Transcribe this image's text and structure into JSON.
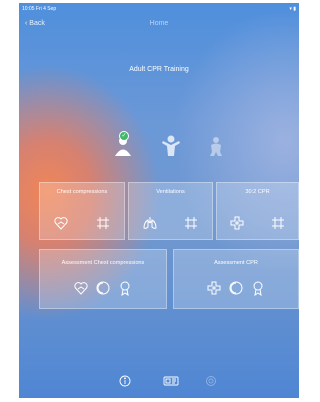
{
  "status": {
    "time": "10:05  Fri 4 Sep",
    "right": "▾ ▮"
  },
  "nav": {
    "back_label": "‹ Back",
    "title": "Home"
  },
  "subtitle": "Adult CPR Training",
  "age_selector": {
    "selected": "adult",
    "badge": "✓"
  },
  "cards": {
    "chest": {
      "title": "Chest compressions"
    },
    "ventilations": {
      "title": "Ventilations"
    },
    "ratio": {
      "title": "30:2 CPR"
    },
    "assess_chest": {
      "title": "Assessment Chest compressions"
    },
    "assess_cpr": {
      "title": "Assessment CPR"
    }
  },
  "colors": {
    "accent": "#40b96a",
    "orange": "#f08658",
    "blue": "#4f8fdc"
  }
}
